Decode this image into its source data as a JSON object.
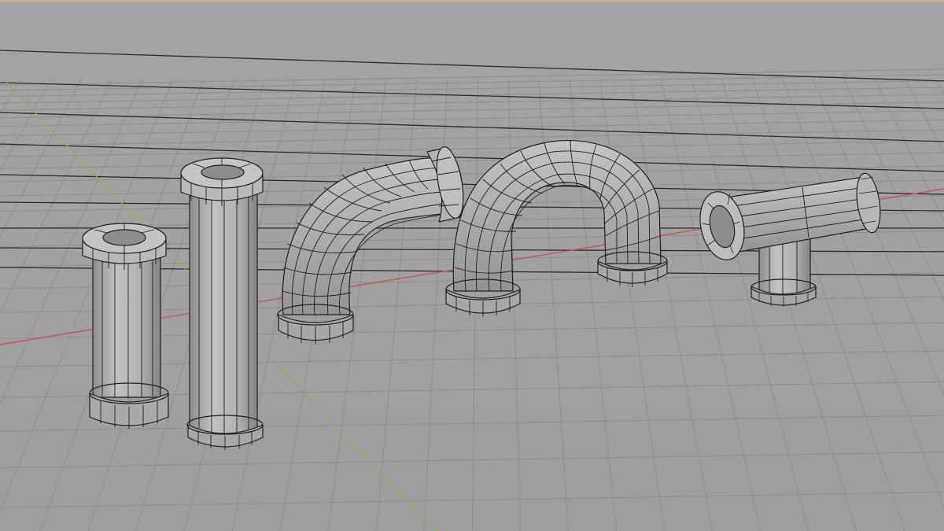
{
  "viewport": {
    "background_top": "#a2a2a2",
    "background_bottom": "#9c9c9c",
    "floor_color": "#a6a6a6",
    "grid_line_color": "#8e8e8e",
    "x_axis_color": "#c8545a",
    "y_axis_color": "#8fae57",
    "mesh_fill": "#b4b4b4",
    "mesh_shade": "#8f8f8f",
    "wire_color": "#1f1f1f"
  },
  "objects": [
    {
      "name": "short-straight-pipe-mesh"
    },
    {
      "name": "long-straight-pipe-mesh"
    },
    {
      "name": "elbow-pipe-mesh"
    },
    {
      "name": "u-bend-pipe-mesh"
    },
    {
      "name": "tee-pipe-mesh"
    }
  ]
}
